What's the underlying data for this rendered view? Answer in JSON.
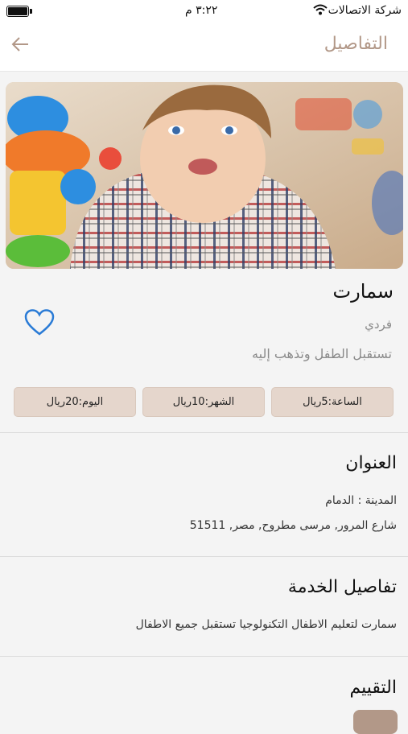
{
  "status": {
    "carrier": "شركة الاتصالات",
    "time": "٣:٢٢ م"
  },
  "header": {
    "title": "التفاصيل",
    "back_icon": "arrow-left-icon"
  },
  "provider": {
    "name": "سمارت",
    "type": "فردي",
    "description": "تستقبل الطفل وتذهب إليه",
    "favorite_icon": "heart-outline-icon",
    "image": "baby-photo"
  },
  "prices": [
    {
      "label": "الساعة:5ريال"
    },
    {
      "label": "الشهر:10ريال"
    },
    {
      "label": "اليوم:20ريال"
    }
  ],
  "address": {
    "title": "العنوان",
    "city": "المدينة : الدمام",
    "street": "شارع المرور, مرسى مطروح, مصر, 51511"
  },
  "service": {
    "title": "تفاصيل الخدمة",
    "text": "سمارت لتعليم الاطفال التكنولوجيا تستقبل جميع الاطفال"
  },
  "rating": {
    "title": "التقييم"
  },
  "colors": {
    "accent": "#b29888",
    "chip": "#e5d6cc",
    "heart": "#2a7bd6"
  }
}
